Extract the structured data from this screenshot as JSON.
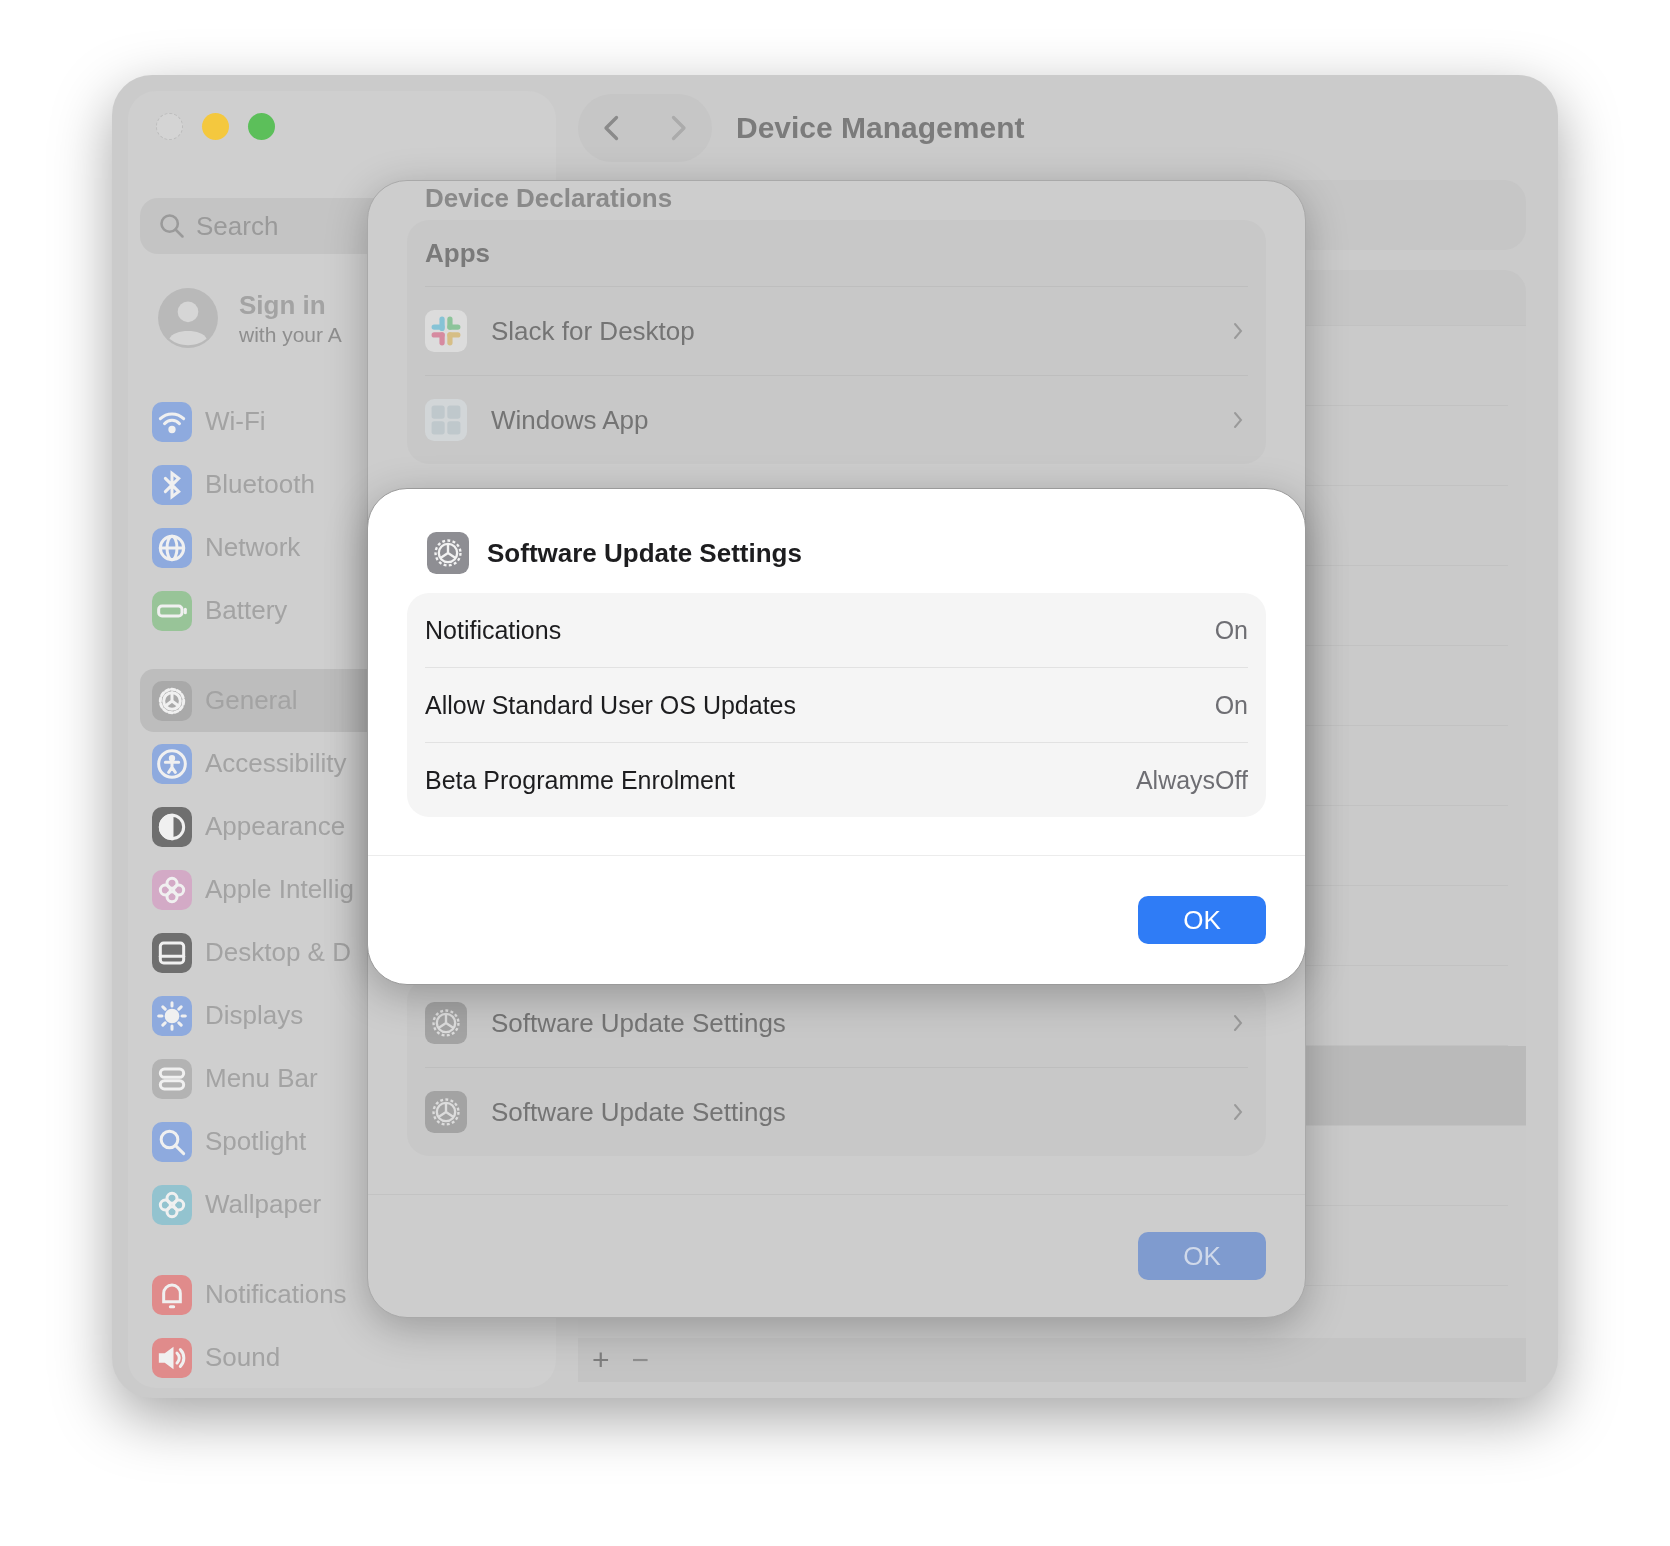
{
  "window": {
    "title": "Device Management",
    "traffic_lights": [
      {
        "kind": "close",
        "color": "#d4d4d4"
      },
      {
        "kind": "minimize",
        "color": "#f4c83e"
      },
      {
        "kind": "zoom",
        "color": "#5cbf5a"
      }
    ]
  },
  "sidebar": {
    "search": {
      "placeholder": "Search"
    },
    "account": {
      "title": "Sign in",
      "subtitle": "with your A"
    },
    "groups": [
      [
        {
          "label": "Wi-Fi",
          "kind": "wifi",
          "color": "#8eaade",
          "selected": false
        },
        {
          "label": "Bluetooth",
          "kind": "bluetooth",
          "color": "#8eaade",
          "selected": false
        },
        {
          "label": "Network",
          "kind": "globe",
          "color": "#8eaade",
          "selected": false
        },
        {
          "label": "Battery",
          "kind": "battery",
          "color": "#98c498",
          "selected": false
        }
      ],
      [
        {
          "label": "General",
          "kind": "gear",
          "color": "#a9a9a9",
          "selected": true
        },
        {
          "label": "Accessibility",
          "kind": "person",
          "color": "#8eaade",
          "selected": false
        },
        {
          "label": "Appearance",
          "kind": "halfcircle",
          "color": "#6f6f6f",
          "selected": false
        },
        {
          "label": "Apple Intellig",
          "kind": "flower",
          "color": "#d3aac6",
          "selected": false
        },
        {
          "label": "Desktop & D",
          "kind": "window",
          "color": "#6f6f6f",
          "selected": false
        },
        {
          "label": "Displays",
          "kind": "sun",
          "color": "#8eaade",
          "selected": false
        },
        {
          "label": "Menu Bar",
          "kind": "toggles",
          "color": "#b3b3b3",
          "selected": false
        },
        {
          "label": "Spotlight",
          "kind": "magnifier",
          "color": "#8eaade",
          "selected": false
        },
        {
          "label": "Wallpaper",
          "kind": "flower",
          "color": "#93c3cf",
          "selected": false
        }
      ],
      [
        {
          "label": "Notifications",
          "kind": "bell",
          "color": "#e08b8b",
          "selected": false
        },
        {
          "label": "Sound",
          "kind": "speaker",
          "color": "#e08b8b",
          "selected": false
        }
      ]
    ]
  },
  "main": {
    "footer": {
      "add": "+",
      "remove": "−"
    }
  },
  "sheet": {
    "heading": "Device Declarations",
    "group_title": "Apps",
    "apps": [
      {
        "name": "Slack for Desktop",
        "kind": "slack"
      },
      {
        "name": "Windows App",
        "kind": "windows"
      }
    ],
    "settings": [
      {
        "name": "Software Update Settings"
      },
      {
        "name": "Software Update Settings"
      }
    ],
    "ok": "OK"
  },
  "dialog": {
    "title": "Software Update Settings",
    "rows": [
      {
        "label": "Notifications",
        "value": "On"
      },
      {
        "label": "Allow Standard User OS Updates",
        "value": "On"
      },
      {
        "label": "Beta Programme Enrolment",
        "value": "AlwaysOff"
      }
    ],
    "ok": "OK"
  }
}
